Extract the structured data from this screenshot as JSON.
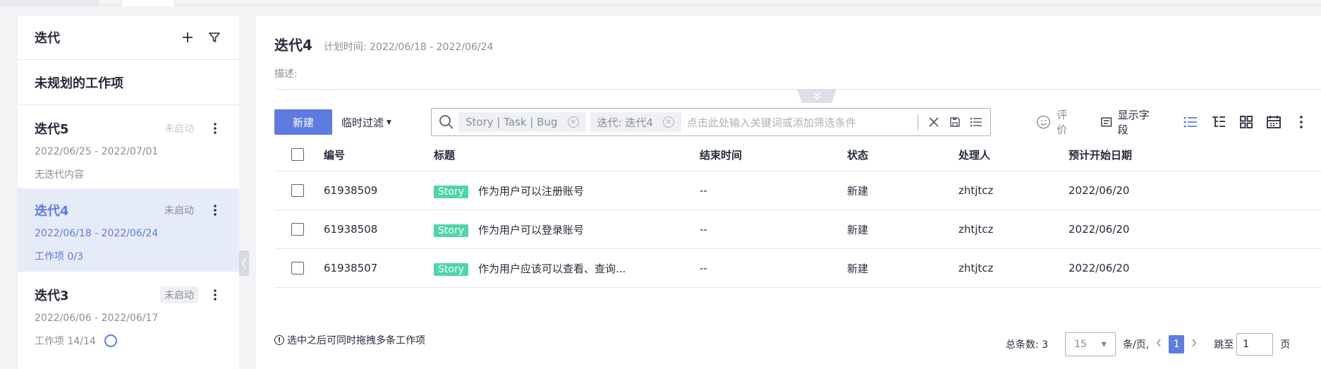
{
  "sidebar": {
    "title": "迭代",
    "unplanned": "未规划的工作项",
    "iterations": [
      {
        "name": "迭代5",
        "status": "未启动",
        "date": "2022/06/25 - 2022/07/01",
        "sub": "无迭代内容"
      },
      {
        "name": "迭代4",
        "status": "未启动",
        "date": "2022/06/18 - 2022/06/24",
        "sub": "工作项 0/3"
      },
      {
        "name": "迭代3",
        "status": "未启动",
        "date": "2022/06/06 - 2022/06/17",
        "sub": "工作项 14/14"
      }
    ]
  },
  "main": {
    "title": "迭代4",
    "plan_time": "计划时间: 2022/06/18 - 2022/06/24",
    "desc_label": "描述:"
  },
  "toolbar": {
    "new_label": "新建",
    "temp_filter_label": "临时过滤",
    "chip_type": "Story  |  Task  |  Bug",
    "chip_iter": "迭代:  迭代4",
    "search_placeholder": "点击此处输入关键词或添加筛选条件",
    "evaluate_label": "评价",
    "show_fields_label": "显示字段"
  },
  "table": {
    "headers": {
      "id": "编号",
      "title": "标题",
      "end": "结束时间",
      "status": "状态",
      "owner": "处理人",
      "start": "预计开始日期"
    },
    "rows": [
      {
        "id": "61938509",
        "tag": "Story",
        "title": "作为用户可以注册账号",
        "end": "--",
        "status": "新建",
        "owner": "zhtjtcz",
        "start": "2022/06/20"
      },
      {
        "id": "61938508",
        "tag": "Story",
        "title": "作为用户可以登录账号",
        "end": "--",
        "status": "新建",
        "owner": "zhtjtcz",
        "start": "2022/06/20"
      },
      {
        "id": "61938507",
        "tag": "Story",
        "title": "作为用户应该可以查看、查询...",
        "end": "--",
        "status": "新建",
        "owner": "zhtjtcz",
        "start": "2022/06/20"
      }
    ]
  },
  "footer": {
    "hint": "选中之后可同时拖拽多条工作项",
    "total": "总条数: 3",
    "page_size": "15",
    "per_page": "条/页,",
    "current_page": "1",
    "jump_label": "跳至",
    "jump_value": "1",
    "page_suffix": "页"
  },
  "colors": {
    "accent": "#5e7ce0",
    "story": "#50d4ab",
    "selected_bg": "#e6ebf8"
  }
}
